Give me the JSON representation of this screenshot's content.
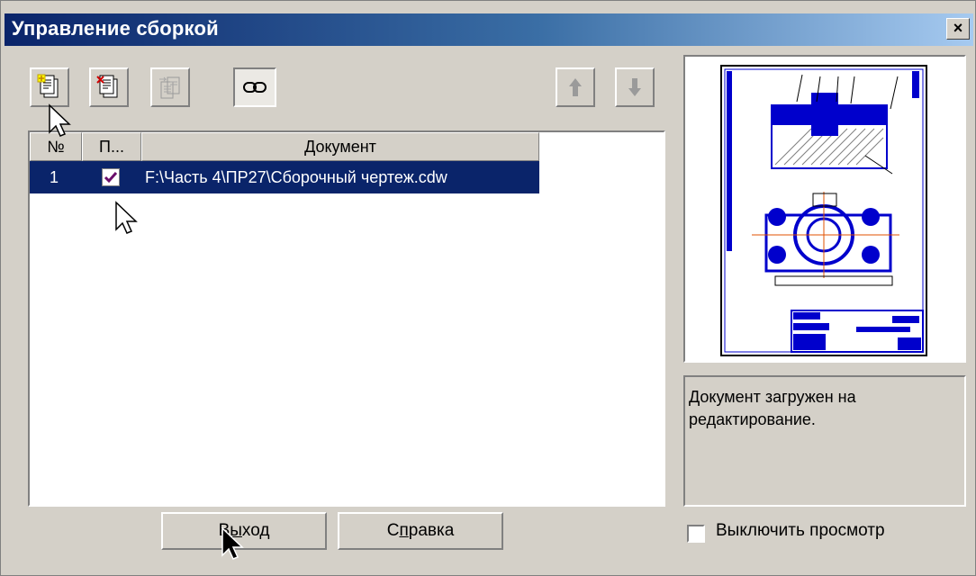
{
  "window": {
    "title": "Управление сборкой",
    "close_glyph": "×"
  },
  "toolbar": {
    "buttons": [
      {
        "name": "add-document",
        "icon": "add-document-icon"
      },
      {
        "name": "remove-document",
        "icon": "remove-document-icon"
      },
      {
        "name": "replace-document",
        "icon": "replace-document-icon",
        "disabled": true
      },
      {
        "name": "link-toggle",
        "icon": "link-icon",
        "pressed": true
      },
      {
        "name": "move-up",
        "icon": "arrow-up-icon",
        "disabled": true
      },
      {
        "name": "move-down",
        "icon": "arrow-down-icon",
        "disabled": true
      }
    ]
  },
  "list": {
    "columns": [
      "№",
      "П...",
      "Документ"
    ],
    "rows": [
      {
        "num": "1",
        "checked": true,
        "document": "F:\\Часть 4\\ПР27\\Сборочный чертеж.cdw"
      }
    ]
  },
  "status_text": "Документ загружен на редактирование.",
  "buttons": {
    "exit_label_pre": "В",
    "exit_label_underline": "ы",
    "exit_label_post": "ход",
    "help_label_pre": "С",
    "help_label_underline": "п",
    "help_label_post": "равка"
  },
  "disable_preview": {
    "label": "Выключить просмотр",
    "checked": false
  },
  "colors": {
    "selection": "#0a246a",
    "drawing_blue": "#0000cc",
    "face": "#d4d0c8"
  }
}
